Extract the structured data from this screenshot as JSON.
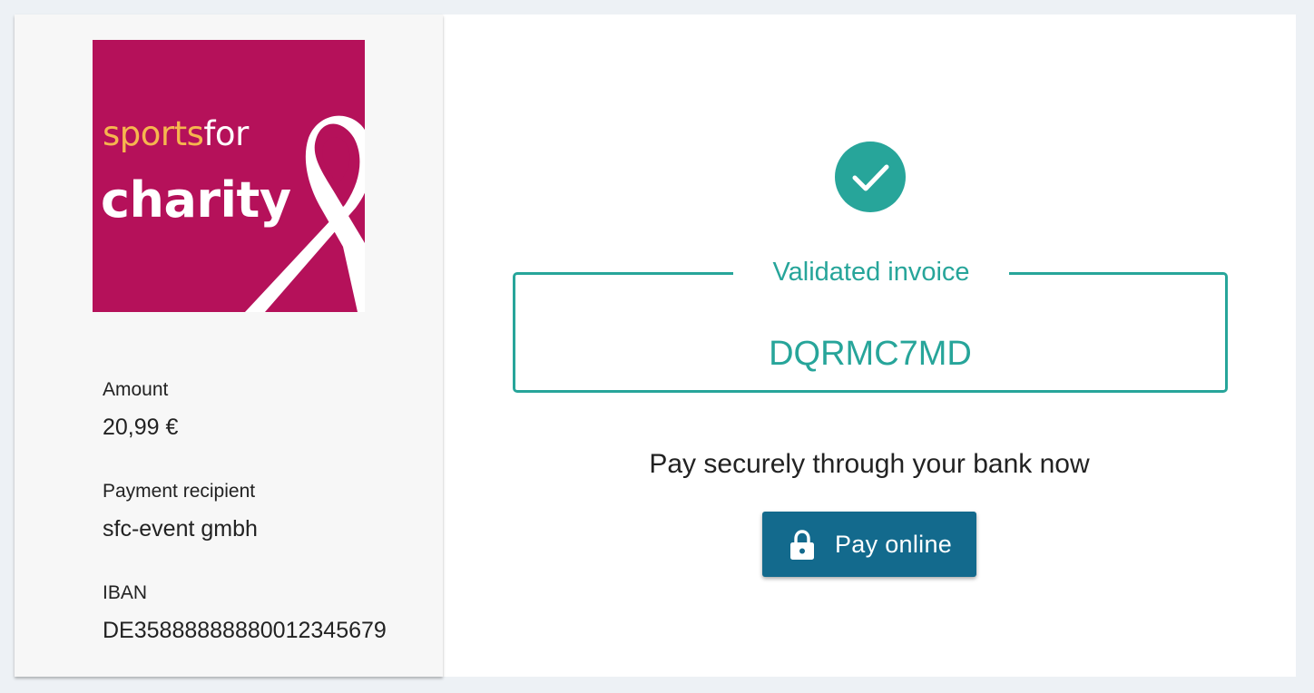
{
  "logo": {
    "word1": "sports",
    "word2": "for",
    "word3": "charity",
    "colors": {
      "background": "#b5115a",
      "accent": "#f6b64e",
      "text": "#ffffff"
    }
  },
  "sidebar": {
    "amount": {
      "label": "Amount",
      "value": "20,99 €"
    },
    "recipient": {
      "label": "Payment recipient",
      "value": "sfc-event gmbh"
    },
    "iban": {
      "label": "IBAN",
      "value": "DE35888888880012345679"
    }
  },
  "main": {
    "status_icon": "check-circle-icon",
    "invoice_legend": "Validated invoice",
    "invoice_code": "DQRMC7MD",
    "pay_text": "Pay securely through your bank now",
    "pay_button": {
      "icon": "lock-icon",
      "label": "Pay online"
    }
  },
  "colors": {
    "accent": "#27a59a",
    "button": "#136a8d",
    "page_background": "#edf1f5",
    "sidebar_background": "#f7f7f7"
  }
}
